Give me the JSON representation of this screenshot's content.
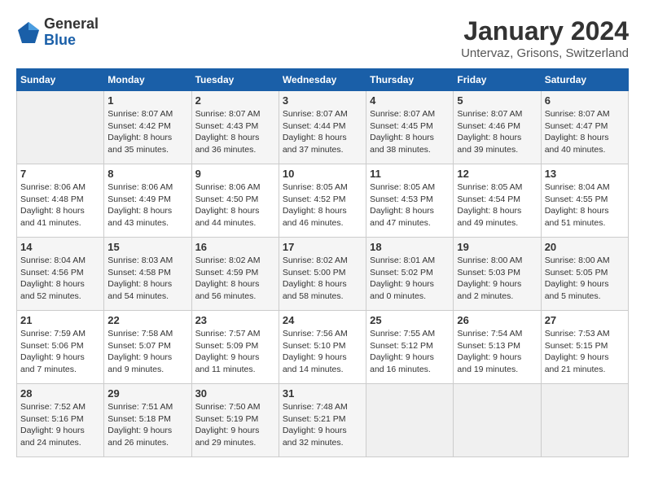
{
  "header": {
    "logo_general": "General",
    "logo_blue": "Blue",
    "title": "January 2024",
    "subtitle": "Untervaz, Grisons, Switzerland"
  },
  "calendar": {
    "days_of_week": [
      "Sunday",
      "Monday",
      "Tuesday",
      "Wednesday",
      "Thursday",
      "Friday",
      "Saturday"
    ],
    "weeks": [
      [
        {
          "day": "",
          "info": ""
        },
        {
          "day": "1",
          "info": "Sunrise: 8:07 AM\nSunset: 4:42 PM\nDaylight: 8 hours\nand 35 minutes."
        },
        {
          "day": "2",
          "info": "Sunrise: 8:07 AM\nSunset: 4:43 PM\nDaylight: 8 hours\nand 36 minutes."
        },
        {
          "day": "3",
          "info": "Sunrise: 8:07 AM\nSunset: 4:44 PM\nDaylight: 8 hours\nand 37 minutes."
        },
        {
          "day": "4",
          "info": "Sunrise: 8:07 AM\nSunset: 4:45 PM\nDaylight: 8 hours\nand 38 minutes."
        },
        {
          "day": "5",
          "info": "Sunrise: 8:07 AM\nSunset: 4:46 PM\nDaylight: 8 hours\nand 39 minutes."
        },
        {
          "day": "6",
          "info": "Sunrise: 8:07 AM\nSunset: 4:47 PM\nDaylight: 8 hours\nand 40 minutes."
        }
      ],
      [
        {
          "day": "7",
          "info": "Sunrise: 8:06 AM\nSunset: 4:48 PM\nDaylight: 8 hours\nand 41 minutes."
        },
        {
          "day": "8",
          "info": "Sunrise: 8:06 AM\nSunset: 4:49 PM\nDaylight: 8 hours\nand 43 minutes."
        },
        {
          "day": "9",
          "info": "Sunrise: 8:06 AM\nSunset: 4:50 PM\nDaylight: 8 hours\nand 44 minutes."
        },
        {
          "day": "10",
          "info": "Sunrise: 8:05 AM\nSunset: 4:52 PM\nDaylight: 8 hours\nand 46 minutes."
        },
        {
          "day": "11",
          "info": "Sunrise: 8:05 AM\nSunset: 4:53 PM\nDaylight: 8 hours\nand 47 minutes."
        },
        {
          "day": "12",
          "info": "Sunrise: 8:05 AM\nSunset: 4:54 PM\nDaylight: 8 hours\nand 49 minutes."
        },
        {
          "day": "13",
          "info": "Sunrise: 8:04 AM\nSunset: 4:55 PM\nDaylight: 8 hours\nand 51 minutes."
        }
      ],
      [
        {
          "day": "14",
          "info": "Sunrise: 8:04 AM\nSunset: 4:56 PM\nDaylight: 8 hours\nand 52 minutes."
        },
        {
          "day": "15",
          "info": "Sunrise: 8:03 AM\nSunset: 4:58 PM\nDaylight: 8 hours\nand 54 minutes."
        },
        {
          "day": "16",
          "info": "Sunrise: 8:02 AM\nSunset: 4:59 PM\nDaylight: 8 hours\nand 56 minutes."
        },
        {
          "day": "17",
          "info": "Sunrise: 8:02 AM\nSunset: 5:00 PM\nDaylight: 8 hours\nand 58 minutes."
        },
        {
          "day": "18",
          "info": "Sunrise: 8:01 AM\nSunset: 5:02 PM\nDaylight: 9 hours\nand 0 minutes."
        },
        {
          "day": "19",
          "info": "Sunrise: 8:00 AM\nSunset: 5:03 PM\nDaylight: 9 hours\nand 2 minutes."
        },
        {
          "day": "20",
          "info": "Sunrise: 8:00 AM\nSunset: 5:05 PM\nDaylight: 9 hours\nand 5 minutes."
        }
      ],
      [
        {
          "day": "21",
          "info": "Sunrise: 7:59 AM\nSunset: 5:06 PM\nDaylight: 9 hours\nand 7 minutes."
        },
        {
          "day": "22",
          "info": "Sunrise: 7:58 AM\nSunset: 5:07 PM\nDaylight: 9 hours\nand 9 minutes."
        },
        {
          "day": "23",
          "info": "Sunrise: 7:57 AM\nSunset: 5:09 PM\nDaylight: 9 hours\nand 11 minutes."
        },
        {
          "day": "24",
          "info": "Sunrise: 7:56 AM\nSunset: 5:10 PM\nDaylight: 9 hours\nand 14 minutes."
        },
        {
          "day": "25",
          "info": "Sunrise: 7:55 AM\nSunset: 5:12 PM\nDaylight: 9 hours\nand 16 minutes."
        },
        {
          "day": "26",
          "info": "Sunrise: 7:54 AM\nSunset: 5:13 PM\nDaylight: 9 hours\nand 19 minutes."
        },
        {
          "day": "27",
          "info": "Sunrise: 7:53 AM\nSunset: 5:15 PM\nDaylight: 9 hours\nand 21 minutes."
        }
      ],
      [
        {
          "day": "28",
          "info": "Sunrise: 7:52 AM\nSunset: 5:16 PM\nDaylight: 9 hours\nand 24 minutes."
        },
        {
          "day": "29",
          "info": "Sunrise: 7:51 AM\nSunset: 5:18 PM\nDaylight: 9 hours\nand 26 minutes."
        },
        {
          "day": "30",
          "info": "Sunrise: 7:50 AM\nSunset: 5:19 PM\nDaylight: 9 hours\nand 29 minutes."
        },
        {
          "day": "31",
          "info": "Sunrise: 7:48 AM\nSunset: 5:21 PM\nDaylight: 9 hours\nand 32 minutes."
        },
        {
          "day": "",
          "info": ""
        },
        {
          "day": "",
          "info": ""
        },
        {
          "day": "",
          "info": ""
        }
      ]
    ]
  }
}
